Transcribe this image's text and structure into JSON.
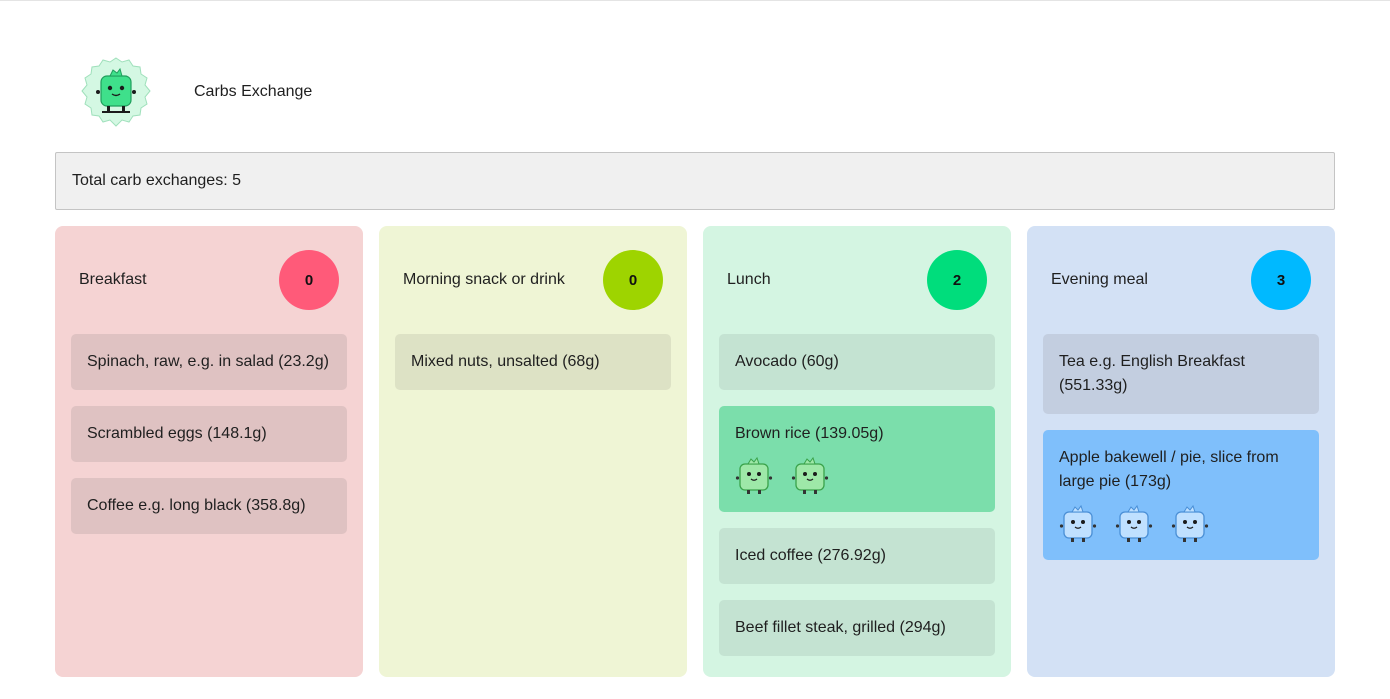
{
  "app": {
    "title": "Carbs Exchange",
    "logo_icon": "green-mascot-logo-icon"
  },
  "summary": {
    "total_label": "Total carb exchanges: 5"
  },
  "colors": {
    "breakfast_bg": "#f5d3d3",
    "breakfast_item": "#dfc2c2",
    "breakfast_badge": "#ff5a79",
    "snack_bg": "#eff5d5",
    "snack_item": "#dde2c5",
    "snack_badge": "#9ed400",
    "lunch_bg": "#d4f5e2",
    "lunch_item": "#c4e3d2",
    "lunch_item_active": "#7bdeab",
    "lunch_badge": "#00dd7c",
    "evening_bg": "#d3e1f5",
    "evening_item": "#c3cee0",
    "evening_item_active": "#7fbffb",
    "evening_badge": "#00b9ff"
  },
  "meals": [
    {
      "title": "Breakfast",
      "count": "0",
      "items": [
        {
          "label": "Spinach, raw, e.g. in salad (23.2g)",
          "exchanges": 0
        },
        {
          "label": "Scrambled eggs (148.1g)",
          "exchanges": 0
        },
        {
          "label": "Coffee e.g. long black (358.8g)",
          "exchanges": 0
        }
      ]
    },
    {
      "title": "Morning snack or drink",
      "count": "0",
      "items": [
        {
          "label": "Mixed nuts, unsalted (68g)",
          "exchanges": 0
        }
      ]
    },
    {
      "title": "Lunch",
      "count": "2",
      "items": [
        {
          "label": "Avocado (60g)",
          "exchanges": 0
        },
        {
          "label": "Brown rice (139.05g)",
          "exchanges": 2,
          "mascot_icon": "green-mascot-icon"
        },
        {
          "label": "Iced coffee (276.92g)",
          "exchanges": 0
        },
        {
          "label": "Beef fillet steak, grilled (294g)",
          "exchanges": 0
        }
      ]
    },
    {
      "title": "Evening meal",
      "count": "3",
      "items": [
        {
          "label": "Tea e.g. English Breakfast (551.33g)",
          "exchanges": 0
        },
        {
          "label": "Apple bakewell / pie, slice from large pie (173g)",
          "exchanges": 3,
          "mascot_icon": "blue-mascot-icon"
        }
      ]
    }
  ]
}
